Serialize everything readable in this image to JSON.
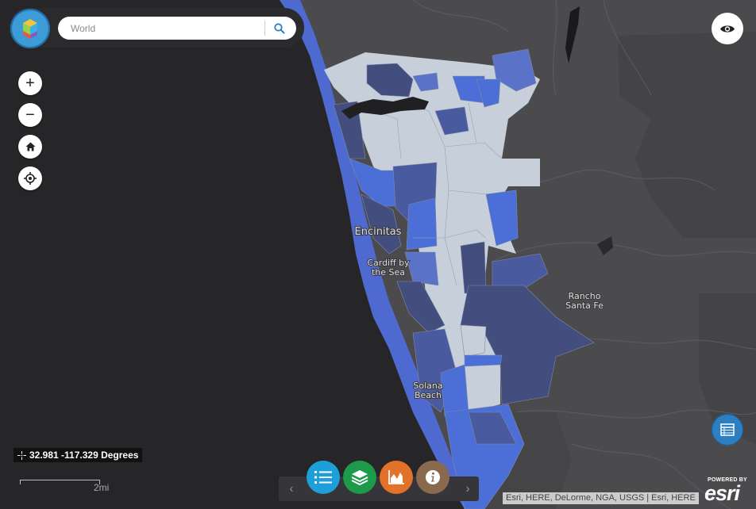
{
  "search": {
    "placeholder": "World"
  },
  "map_labels": {
    "encinitas": "Encinitas",
    "cardiff_line1": "Cardiff by",
    "cardiff_line2": "the Sea",
    "rancho_line1": "Rancho",
    "rancho_line2": "Santa Fe",
    "solana_line1": "Solana",
    "solana_line2": "Beach"
  },
  "nav": {
    "zoom_in": "+",
    "zoom_out": "−"
  },
  "coordinates": {
    "text": "32.981 -117.329 Degrees"
  },
  "scale": {
    "label": "2mi"
  },
  "attribution": "Esri, HERE, DeLorme, NGA, USGS | Esri, HERE",
  "esri": {
    "powered_by": "POWERED BY",
    "brand": "esri"
  },
  "toolbar": {
    "prev": "‹",
    "next": "›",
    "buttons": [
      {
        "icon": "list-icon",
        "color": "#1e9fd9"
      },
      {
        "icon": "layers-icon",
        "color": "#1d9a4a"
      },
      {
        "icon": "chart-icon",
        "color": "#e2722a"
      },
      {
        "icon": "info-icon",
        "color": "#8a6a4e"
      }
    ]
  },
  "colors": {
    "ocean": "#262629",
    "land": "#4b4b4e",
    "class_light": "#c5cdd9",
    "class_medium": "#5a73c8",
    "class_bright": "#4b6fd6",
    "class_dark": "#434d7e"
  }
}
